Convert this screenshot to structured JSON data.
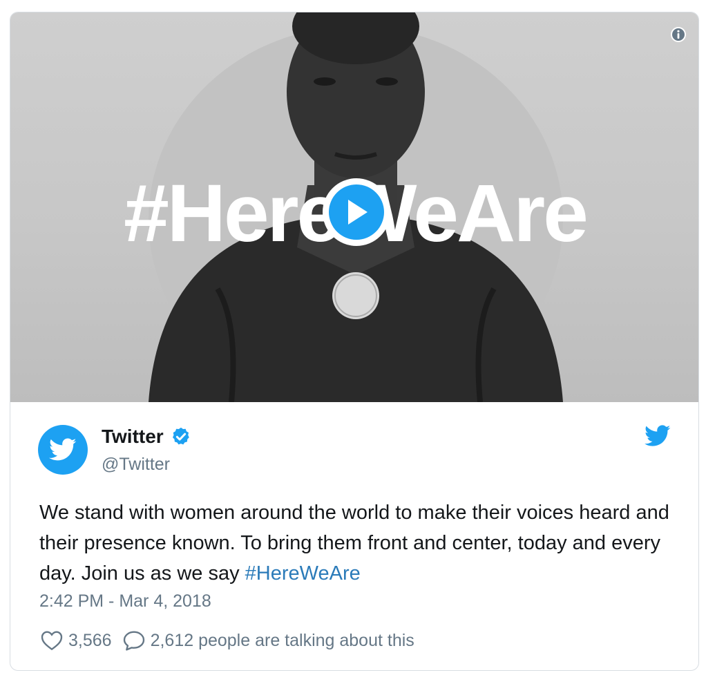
{
  "media": {
    "overlay_text": "#HereWeAre",
    "play_icon": "play-icon",
    "info_icon": "info-icon"
  },
  "author": {
    "name": "Twitter",
    "handle": "@Twitter",
    "verified_icon": "verified-badge-icon",
    "avatar_icon": "twitter-bird-icon"
  },
  "tweet": {
    "text": "We stand with women around the world to make their voices heard and their presence known. To bring them front and center, today and every day. Join us as we say ",
    "hashtag": "#HereWeAre",
    "timestamp": "2:42 PM - Mar 4, 2018"
  },
  "stats": {
    "likes": "3,566",
    "replies_text": "2,612 people are talking about this"
  },
  "colors": {
    "brand": "#1da1f2",
    "link": "#2b7bb9",
    "secondary_text": "#657786",
    "primary_text": "#14171a"
  }
}
